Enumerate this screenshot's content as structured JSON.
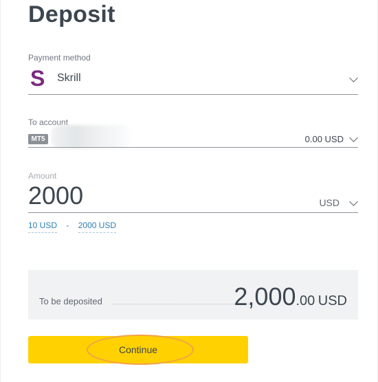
{
  "page": {
    "title": "Deposit"
  },
  "payment_method": {
    "label": "Payment method",
    "value": "Skrill",
    "icon": "skrill-logo",
    "brand_color": "#7b2b7f"
  },
  "to_account": {
    "label": "To account",
    "platform_badge": "MT5",
    "balance": "0.00 USD"
  },
  "amount": {
    "label": "Amount",
    "value": "2000",
    "currency": "USD",
    "min": "10 USD",
    "separator": "-",
    "max": "2000 USD"
  },
  "summary": {
    "label": "To be deposited",
    "amount_integer": "2,000",
    "amount_decimal": ".00",
    "currency": "USD"
  },
  "actions": {
    "continue_label": "Continue",
    "accent_color": "#ffd100"
  }
}
